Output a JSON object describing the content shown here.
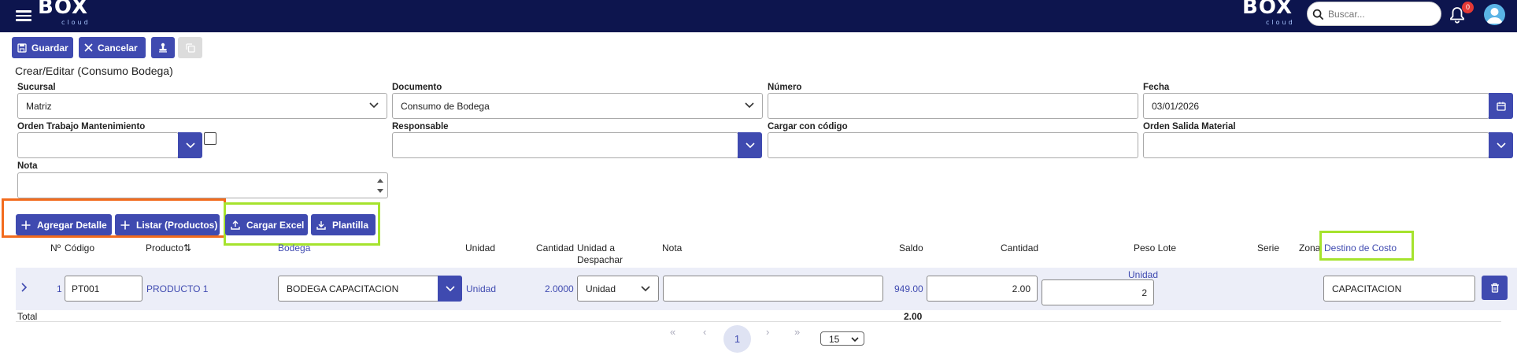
{
  "header": {
    "logo_main": "BOX",
    "logo_sub": "cloud",
    "search_placeholder": "Buscar...",
    "notification_count": "0"
  },
  "toolbar": {
    "save_label": "Guardar",
    "cancel_label": "Cancelar"
  },
  "page_title": "Crear/Editar (Consumo Bodega)",
  "form": {
    "sucursal": {
      "label": "Sucursal",
      "value": "Matriz"
    },
    "documento": {
      "label": "Documento",
      "value": "Consumo de Bodega"
    },
    "numero": {
      "label": "Número",
      "value": ""
    },
    "fecha": {
      "label": "Fecha",
      "value": "03/01/2026"
    },
    "orden_trabajo": {
      "label": "Orden Trabajo Mantenimiento",
      "value": ""
    },
    "responsable": {
      "label": "Responsable",
      "value": ""
    },
    "cargar_codigo": {
      "label": "Cargar con código",
      "value": ""
    },
    "orden_salida": {
      "label": "Orden Salida Material",
      "value": ""
    },
    "nota": {
      "label": "Nota",
      "value": ""
    }
  },
  "actions": {
    "agregar": "Agregar Detalle",
    "listar": "Listar (Productos)",
    "cargar_excel": "Cargar Excel",
    "plantilla": "Plantilla"
  },
  "table": {
    "headers": {
      "num": "Nº",
      "codigo": "Código",
      "producto": "Producto",
      "bodega": "Bodega",
      "unidad": "Unidad",
      "cantidad": "Cantidad",
      "unidad_despachar_1": "Unidad a",
      "unidad_despachar_2": "Despachar",
      "nota": "Nota",
      "saldo": "Saldo",
      "cantidad2": "Cantidad",
      "peso_lote": "Peso Lote",
      "serie": "Serie",
      "zona": "Zona",
      "destino": "Destino de Costo"
    },
    "rows": [
      {
        "num": "1",
        "codigo": "PT001",
        "producto": "PRODUCTO 1",
        "bodega": "BODEGA CAPACITACION",
        "unidad": "Unidad",
        "cantidad": "2.0000",
        "unidad_despachar": "Unidad",
        "nota": "",
        "saldo": "949.00",
        "cantidad2": "2.00",
        "peso_unidad": "Unidad",
        "peso_value": "2",
        "destino": "CAPACITACION"
      }
    ],
    "total_label": "Total",
    "total_value": "2.00"
  },
  "pagination": {
    "first": "«",
    "prev": "‹",
    "current": "1",
    "next": "›",
    "last": "»",
    "page_size": "15"
  },
  "colors": {
    "nav_bg": "#0d154e",
    "primary": "#3f4ab0",
    "highlight_orange": "#f26b1d",
    "highlight_green": "#a5e32d"
  }
}
